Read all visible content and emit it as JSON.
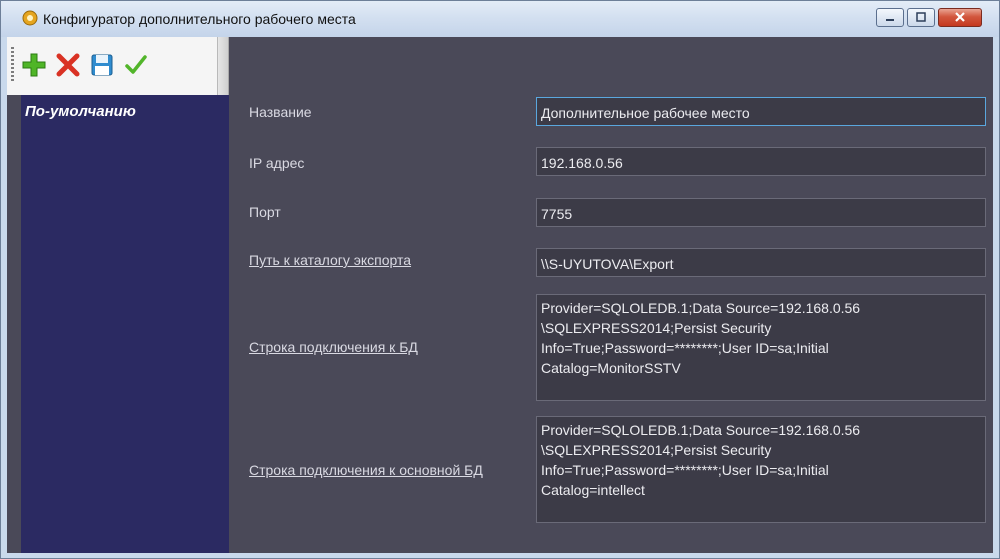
{
  "window": {
    "title": "Конфигуратор дополнительного рабочего места"
  },
  "toolbar": {
    "buttons": [
      {
        "icon": "add-icon"
      },
      {
        "icon": "delete-icon"
      },
      {
        "icon": "save-icon"
      },
      {
        "icon": "apply-check-icon"
      }
    ]
  },
  "sidebar": {
    "items": [
      {
        "label": "По-умолчанию"
      }
    ]
  },
  "form": {
    "name_label": "Название",
    "name_value": "Дополнительное рабочее место",
    "ip_label": "IP адрес",
    "ip_value": "192.168.0.56",
    "port_label": "Порт",
    "port_value": "7755",
    "export_label": "Путь к каталогу экспорта",
    "export_value": "\\\\S-UYUTOVA\\Export",
    "db_label": "Строка подключения к БД",
    "db_value": "Provider=SQLOLEDB.1;Data Source=192.168.0.56\n\\SQLEXPRESS2014;Persist Security\nInfo=True;Password=********;User ID=sa;Initial\nCatalog=MonitorSSTV",
    "maindb_label": "Строка подключения к основной БД",
    "maindb_value": "Provider=SQLOLEDB.1;Data Source=192.168.0.56\n\\SQLEXPRESS2014;Persist Security\nInfo=True;Password=********;User ID=sa;Initial\nCatalog=intellect"
  },
  "colors": {
    "panel": "#4a4958",
    "sidebar": "#2b2a62",
    "field": "#3c3b47",
    "focus": "#5aa7de"
  }
}
